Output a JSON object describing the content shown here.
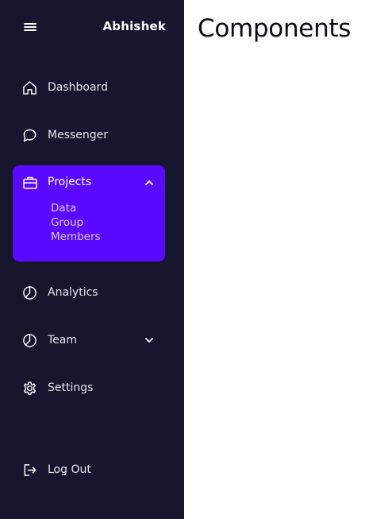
{
  "sidebar": {
    "brand": "Abhishek",
    "items": [
      {
        "label": "Dashboard",
        "icon": "home-icon"
      },
      {
        "label": "Messenger",
        "icon": "chat-icon"
      },
      {
        "label": "Projects",
        "icon": "briefcase-icon",
        "expanded": true,
        "children": [
          {
            "label": "Data"
          },
          {
            "label": "Group"
          },
          {
            "label": "Members"
          }
        ]
      },
      {
        "label": "Analytics",
        "icon": "pie-chart-icon"
      },
      {
        "label": "Team",
        "icon": "pie-chart-icon",
        "expanded": false
      },
      {
        "label": "Settings",
        "icon": "gear-icon"
      }
    ],
    "logout": {
      "label": "Log Out",
      "icon": "logout-icon"
    }
  },
  "main": {
    "title": "Components"
  },
  "colors": {
    "sidebar_bg": "#16162e",
    "active_bg": "#5b08ff",
    "text": "#ffffff",
    "main_bg": "#ffffff"
  }
}
